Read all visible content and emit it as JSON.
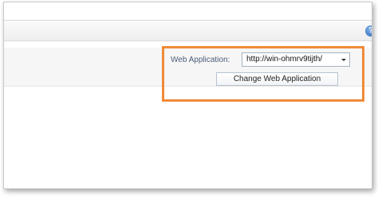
{
  "header": {
    "help_icon_glyph": "?"
  },
  "web_app_picker": {
    "label": "Web Application:",
    "selected_value": "http://win-ohmrv9tijth/",
    "change_button_label": "Change Web Application"
  },
  "colors": {
    "highlight": "#f08a38"
  }
}
